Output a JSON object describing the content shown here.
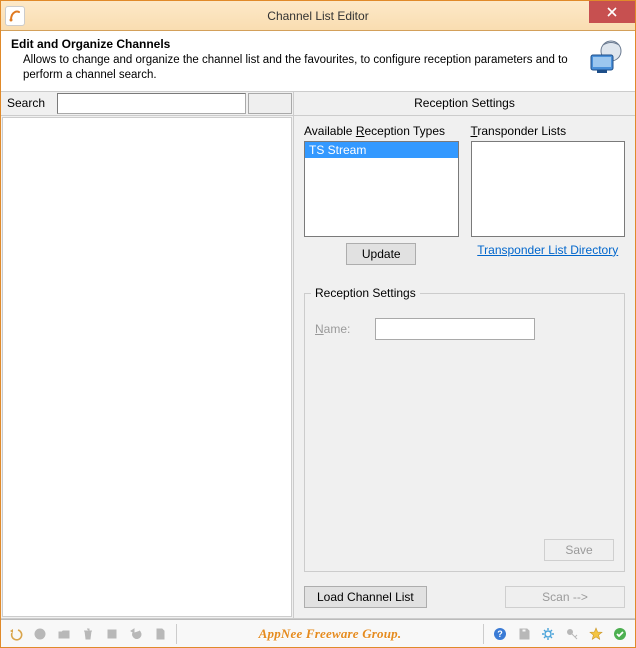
{
  "window": {
    "title": "Channel List Editor"
  },
  "header": {
    "title": "Edit and Organize Channels",
    "desc": "Allows to change and organize the channel list and the favourites, to configure reception parameters and to perform a channel search."
  },
  "search": {
    "label": "Search",
    "value": "",
    "button": ""
  },
  "right": {
    "title": "Reception Settings",
    "available_label_pre": "Available ",
    "available_label_u": "R",
    "available_label_post": "eception Types",
    "transponder_label_u": "T",
    "transponder_label_post": "ransponder Lists",
    "reception_types": [
      "TS Stream"
    ],
    "transponder_lists": [],
    "update_btn": "Update",
    "dir_link": "Transponder List Directory",
    "group_legend": "Reception Settings",
    "name_label_u": "N",
    "name_label_post": "ame:",
    "name_value": "",
    "save_btn": "Save",
    "load_btn": "Load Channel List",
    "scan_btn": "Scan -->"
  },
  "status": {
    "watermark": "AppNee Freeware Group."
  }
}
